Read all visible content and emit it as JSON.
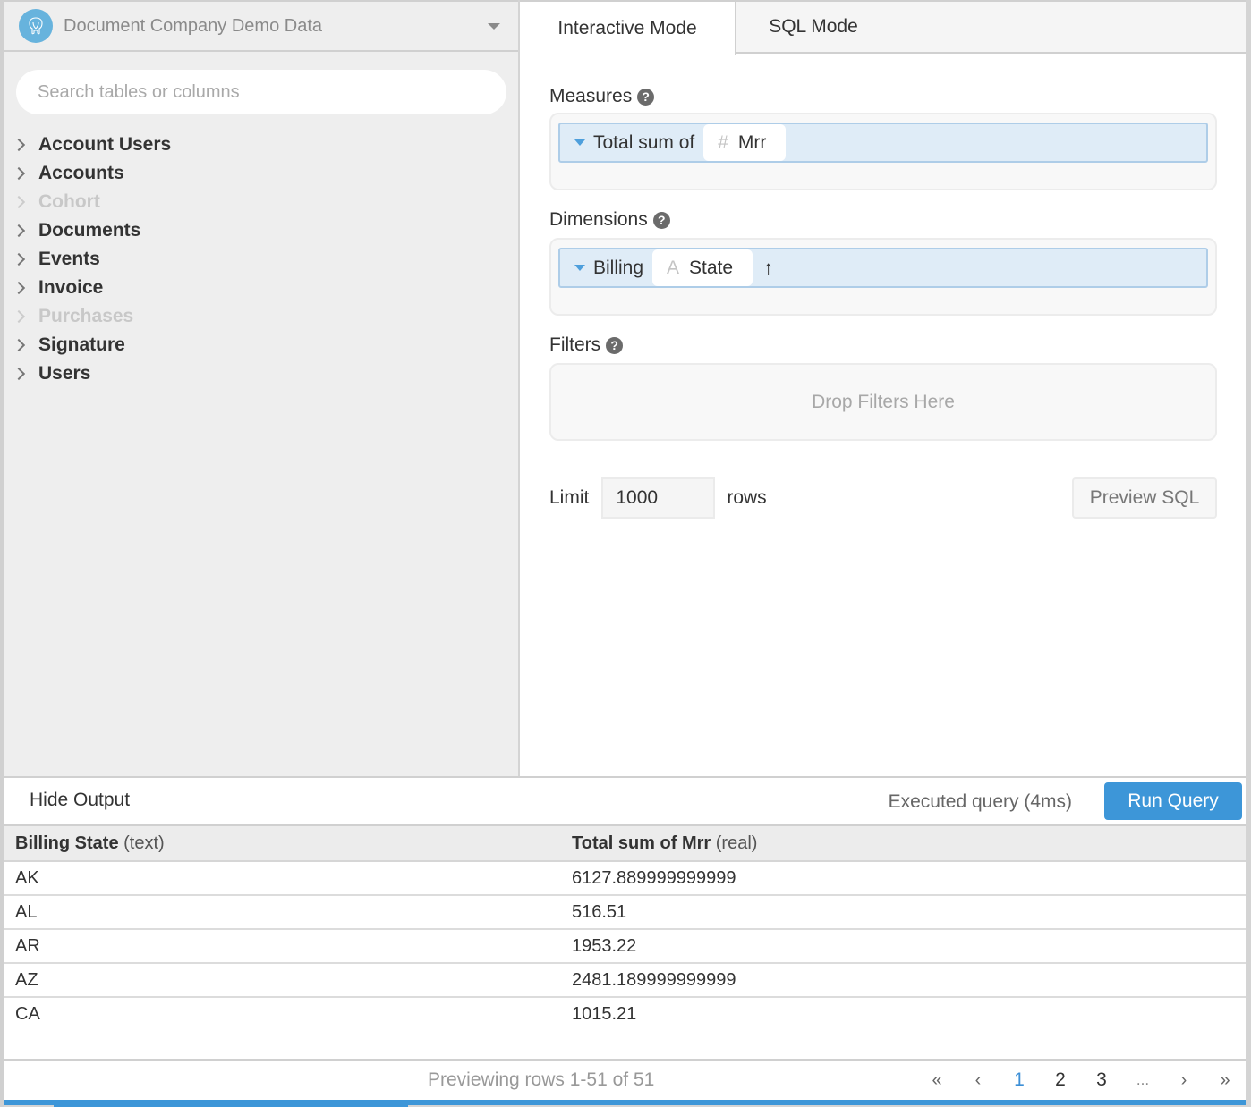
{
  "sidebar": {
    "database": {
      "name": "Document Company Demo Data",
      "icon": "postgresql-elephant-icon"
    },
    "search": {
      "placeholder": "Search tables or columns",
      "value": ""
    },
    "tables": [
      {
        "label": "Account Users",
        "enabled": true
      },
      {
        "label": "Accounts",
        "enabled": true
      },
      {
        "label": "Cohort",
        "enabled": false
      },
      {
        "label": "Documents",
        "enabled": true
      },
      {
        "label": "Events",
        "enabled": true
      },
      {
        "label": "Invoice",
        "enabled": true
      },
      {
        "label": "Purchases",
        "enabled": false
      },
      {
        "label": "Signature",
        "enabled": true
      },
      {
        "label": "Users",
        "enabled": true
      }
    ]
  },
  "main": {
    "tabs": [
      {
        "label": "Interactive Mode",
        "active": true
      },
      {
        "label": "SQL Mode",
        "active": false
      }
    ],
    "measures": {
      "label": "Measures",
      "help_icon": "?",
      "item": {
        "aggregation": "Total sum of",
        "field_icon": "#",
        "field": "Mrr"
      }
    },
    "dimensions": {
      "label": "Dimensions",
      "help_icon": "?",
      "item": {
        "prefix": "Billing",
        "field_icon": "A",
        "field": "State",
        "sort_icon": "↑"
      }
    },
    "filters": {
      "label": "Filters",
      "help_icon": "?",
      "placeholder": "Drop Filters Here"
    },
    "limit": {
      "label": "Limit",
      "value": "1000",
      "suffix": "rows"
    },
    "preview_sql_label": "Preview SQL"
  },
  "output": {
    "hide_label": "Hide Output",
    "status": "Executed query (4ms)",
    "run_label": "Run Query",
    "columns": [
      {
        "name": "Billing State",
        "type": "(text)"
      },
      {
        "name": "Total sum of Mrr",
        "type": "(real)"
      }
    ],
    "rows": [
      [
        "AK",
        "6127.889999999999"
      ],
      [
        "AL",
        "516.51"
      ],
      [
        "AR",
        "1953.22"
      ],
      [
        "AZ",
        "2481.189999999999"
      ],
      [
        "CA",
        "1015.21"
      ]
    ],
    "preview_text": "Previewing rows 1-51 of 51",
    "pagination": {
      "first": "«",
      "prev": "‹",
      "pages": [
        "1",
        "2",
        "3"
      ],
      "current_page": "1",
      "ellipsis": "...",
      "next": "›",
      "last": "»"
    }
  },
  "colors": {
    "accent": "#3d96d8",
    "pill_bg": "#dfecf7",
    "pill_border": "#aecde8",
    "sidebar_bg": "#eeeeee",
    "db_icon_bg": "#67b3dd"
  }
}
